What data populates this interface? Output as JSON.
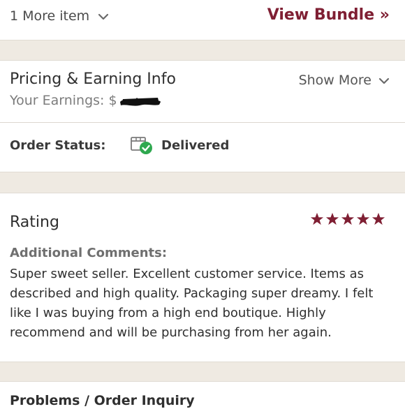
{
  "bundle": {
    "more_items_label": "1 More item",
    "view_bundle_label": "View Bundle »"
  },
  "pricing": {
    "title": "Pricing & Earning Info",
    "show_more_label": "Show More",
    "earnings_label": "Your Earnings: $"
  },
  "order": {
    "status_label": "Order Status:",
    "status_value": "Delivered"
  },
  "rating": {
    "title": "Rating",
    "stars": 5,
    "comments_label": "Additional Comments:",
    "comments_text": "Super sweet seller. Excellent customer service. Items as described and high quality. Packaging super dreamy. I felt like I was buying from a high end boutique. Highly recommend and will be purchasing from her again."
  },
  "problems": {
    "title": "Problems / Order Inquiry"
  },
  "colors": {
    "accent": "#7f1f33",
    "success": "#2fa84f",
    "background": "#efeae2"
  }
}
